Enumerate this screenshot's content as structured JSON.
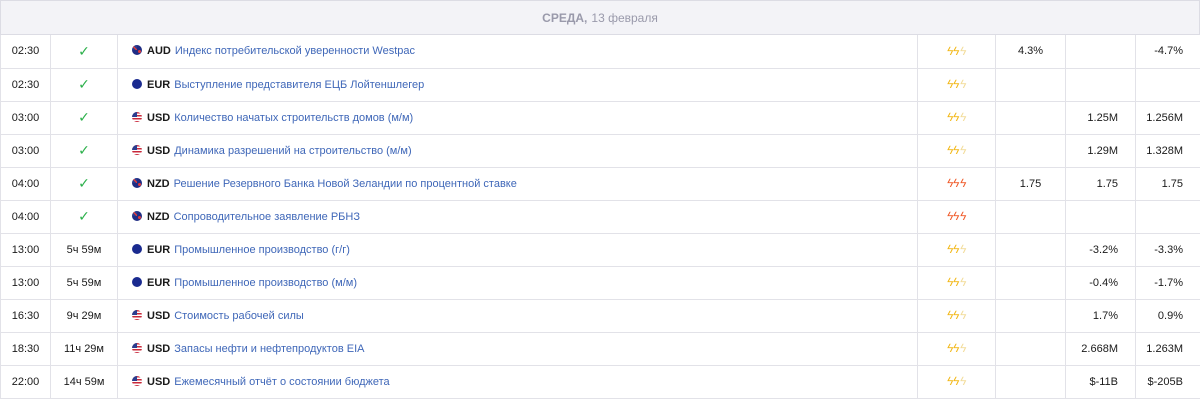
{
  "day": {
    "weekday": "СРЕДА,",
    "date": "13 февраля"
  },
  "colors": {
    "check": "#2bb04a",
    "event_link": "#3f67b8",
    "impact_medium": "#f2b818",
    "impact_high": "#f05a2a"
  },
  "rows": [
    {
      "time": "02:30",
      "status": "✓",
      "status_icon": "check-icon",
      "flag": "au",
      "currency": "AUD",
      "event": "Индекс потребительской уверенности Westpac",
      "impact": "medium",
      "actual": "4.3%",
      "forecast": "",
      "previous": "-4.7%"
    },
    {
      "time": "02:30",
      "status": "✓",
      "status_icon": "check-icon",
      "flag": "eu",
      "currency": "EUR",
      "event": "Выступление представителя ЕЦБ Лойтеншлегер",
      "impact": "medium",
      "actual": "",
      "forecast": "",
      "previous": ""
    },
    {
      "time": "03:00",
      "status": "✓",
      "status_icon": "check-icon",
      "flag": "us",
      "currency": "USD",
      "event": "Количество начатых строительств домов (м/м)",
      "impact": "medium",
      "actual": "",
      "forecast": "1.25M",
      "previous": "1.256M"
    },
    {
      "time": "03:00",
      "status": "✓",
      "status_icon": "check-icon",
      "flag": "us",
      "currency": "USD",
      "event": "Динамика разрешений на строительство (м/м)",
      "impact": "medium",
      "actual": "",
      "forecast": "1.29M",
      "previous": "1.328M"
    },
    {
      "time": "04:00",
      "status": "✓",
      "status_icon": "check-icon",
      "flag": "nz",
      "currency": "NZD",
      "event": "Решение Резервного Банка Новой Зеландии по процентной ставке",
      "impact": "high",
      "actual": "1.75",
      "forecast": "1.75",
      "previous": "1.75"
    },
    {
      "time": "04:00",
      "status": "✓",
      "status_icon": "check-icon",
      "flag": "nz",
      "currency": "NZD",
      "event": "Сопроводительное заявление РБНЗ",
      "impact": "high",
      "actual": "",
      "forecast": "",
      "previous": ""
    },
    {
      "time": "13:00",
      "status": "5ч 59м",
      "status_icon": "",
      "flag": "eu",
      "currency": "EUR",
      "event": "Промышленное производство (г/г)",
      "impact": "medium",
      "actual": "",
      "forecast": "-3.2%",
      "previous": "-3.3%"
    },
    {
      "time": "13:00",
      "status": "5ч 59м",
      "status_icon": "",
      "flag": "eu",
      "currency": "EUR",
      "event": "Промышленное производство (м/м)",
      "impact": "medium",
      "actual": "",
      "forecast": "-0.4%",
      "previous": "-1.7%"
    },
    {
      "time": "16:30",
      "status": "9ч 29м",
      "status_icon": "",
      "flag": "us",
      "currency": "USD",
      "event": "Стоимость рабочей силы",
      "impact": "medium",
      "actual": "",
      "forecast": "1.7%",
      "previous": "0.9%"
    },
    {
      "time": "18:30",
      "status": "11ч 29м",
      "status_icon": "",
      "flag": "us",
      "currency": "USD",
      "event": "Запасы нефти и нефтепродуктов EIA",
      "impact": "medium",
      "actual": "",
      "forecast": "2.668M",
      "previous": "1.263M"
    },
    {
      "time": "22:00",
      "status": "14ч 59м",
      "status_icon": "",
      "flag": "us",
      "currency": "USD",
      "event": "Ежемесячный отчёт о состоянии бюджета",
      "impact": "medium",
      "actual": "",
      "forecast": "$-11B",
      "previous": "$-205B"
    }
  ]
}
